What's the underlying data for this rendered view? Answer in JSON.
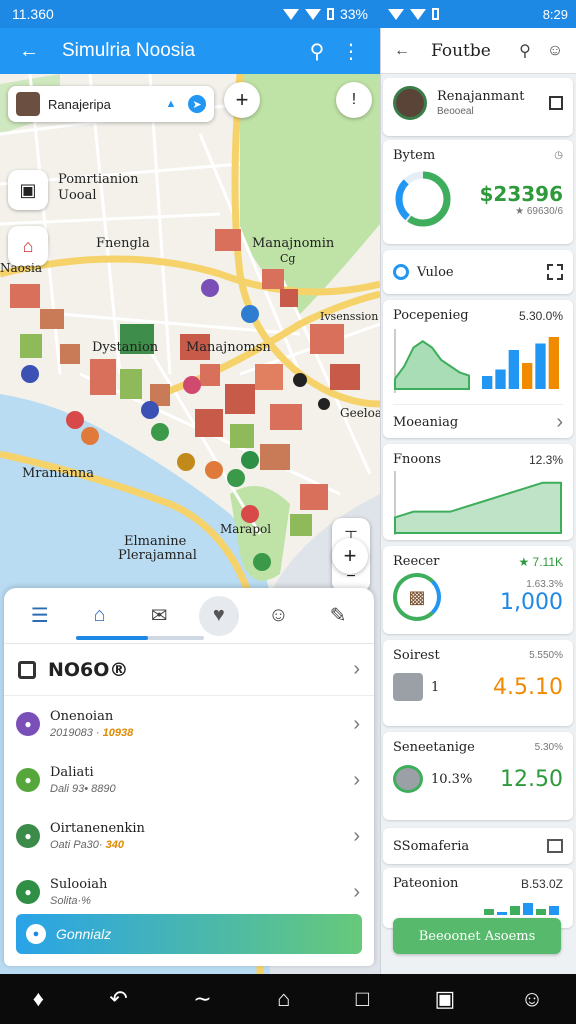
{
  "status_left": {
    "time": "11.360",
    "icons": [
      "wifi-icon",
      "signal-icon",
      "battery-icon"
    ],
    "battery": "33%"
  },
  "status_right": {
    "battery": "33%",
    "time": "8:29"
  },
  "appbar": {
    "title": "Simulria Noosia"
  },
  "search_chip": {
    "label": "Ranajeripa"
  },
  "map": {
    "labels": {
      "poi1_line1": "Pomrtianion",
      "poi1_line2": "Uooal",
      "fnengla": "Fnengla",
      "naosia": "Naosia",
      "manajnomin": "Manajnomin",
      "cg": "Cg",
      "dystanion": "Dystanion",
      "manajnomsn": "Manajnomsn",
      "ivsenssion": "Ivsenssion",
      "geeloar": "Geeloar",
      "mranianna": "Mranianna",
      "elmanine": "Elmanine",
      "pleranjamnal": "Plerajamnal",
      "marapol": "Marapol"
    }
  },
  "sheet": {
    "tabs": [
      "list-icon",
      "home-icon",
      "mail-icon",
      "heart-icon",
      "person-icon",
      "edit-icon"
    ],
    "header_title": "NO6O®",
    "items": [
      {
        "title": "Onenoian",
        "sub": "2019083 · ",
        "hl": "10938",
        "icon": "lock-icon",
        "color": "#7b4fb8"
      },
      {
        "title": "Daliati",
        "sub": "Dali 93• 8890",
        "hl": "",
        "icon": "leaf-icon",
        "color": "#55a63b"
      },
      {
        "title": "Oirtanenenkin",
        "sub": "Oati Pa30· ",
        "hl": "340",
        "icon": "check-icon",
        "color": "#3d8b4a"
      },
      {
        "title": "Sulooiah",
        "sub": "Solita·%",
        "hl": "",
        "icon": "pin-icon",
        "color": "#2e8f45"
      }
    ],
    "cta": "Gonnialz"
  },
  "rpanel": {
    "title": "Foutbe",
    "profile": {
      "name": "Renajanmant",
      "sub": "Beooeal"
    },
    "bytem": {
      "title": "Bytem",
      "value": "$23396",
      "sub": "★ 69630/6"
    },
    "vuloe": {
      "title": "Vuloe"
    },
    "pocenge": {
      "title": "Pocepenieg",
      "value": "5.30.0%",
      "label": "Moeaniag"
    },
    "fnoons": {
      "title": "Fnoons",
      "value": "12.3%"
    },
    "recer": {
      "title": "Reecer",
      "top": "★ 7.11K",
      "sub": "1.63.3%",
      "value": "1,000"
    },
    "soirest": {
      "title": "Soirest",
      "top": "5.550%",
      "num": "1",
      "value": "4.5.10"
    },
    "seneetange": {
      "title": "Seneetanige",
      "top": "5.30%",
      "num": "10.3%",
      "value": "12.50"
    },
    "ssomaferia": {
      "title": "SSomaferia"
    },
    "pateonion": {
      "title": "Pateonion",
      "value": "B.53.0Z"
    },
    "button": "Beeoonet Asoems"
  },
  "chart_data": [
    {
      "type": "area",
      "title": "",
      "values": [
        1,
        3,
        6,
        7,
        6,
        4,
        3,
        2,
        1.5
      ]
    },
    {
      "type": "bar",
      "title": "",
      "values": [
        2,
        3,
        6,
        4,
        7,
        8
      ]
    },
    {
      "type": "area",
      "title": "",
      "values": [
        2,
        3,
        3,
        3,
        4,
        5,
        6,
        7,
        8,
        8
      ]
    },
    {
      "type": "bar",
      "title": "",
      "values": [
        2,
        1,
        3,
        4,
        2,
        3
      ]
    }
  ],
  "colors": {
    "primary": "#2196f3",
    "green": "#2e9a3b",
    "orange": "#f08a00"
  }
}
